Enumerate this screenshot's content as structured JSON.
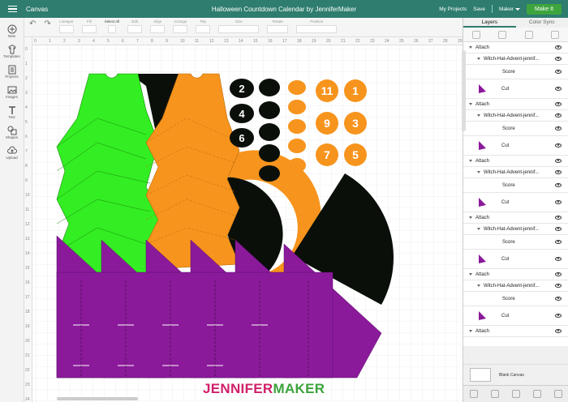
{
  "topbar": {
    "app_title": "Canvas",
    "doc_title": "Halloween Countdown Calendar by JenniferMaker",
    "my_projects": "My Projects",
    "save": "Save",
    "machine": "Maker",
    "make_it": "Make It",
    "color": "#2e7d6e"
  },
  "toolbar": {
    "items": [
      "Linetype",
      "Fill",
      "Select All",
      "Edit",
      "Align",
      "Arrange",
      "Flip",
      "Size",
      "Rotate",
      "Position"
    ]
  },
  "sidebar": {
    "items": [
      {
        "label": "New",
        "icon": "plus-icon"
      },
      {
        "label": "Templates",
        "icon": "shirt-icon"
      },
      {
        "label": "Projects",
        "icon": "projects-icon"
      },
      {
        "label": "Images",
        "icon": "image-icon"
      },
      {
        "label": "Text",
        "icon": "text-icon"
      },
      {
        "label": "Shapes",
        "icon": "shapes-icon"
      },
      {
        "label": "Upload",
        "icon": "cloud-upload-icon"
      }
    ]
  },
  "rulers": {
    "top": [
      "0",
      "1",
      "2",
      "3",
      "4",
      "5",
      "6",
      "7",
      "8",
      "9",
      "10",
      "11",
      "12",
      "13",
      "14",
      "15",
      "16",
      "17",
      "18",
      "19",
      "20",
      "21",
      "22",
      "23",
      "24",
      "25",
      "26",
      "27",
      "28",
      "29"
    ],
    "left": [
      "0",
      "1",
      "2",
      "3",
      "4",
      "5",
      "6",
      "7",
      "8",
      "9",
      "10",
      "11",
      "12",
      "13",
      "14",
      "15",
      "16",
      "17",
      "18",
      "19",
      "20",
      "21",
      "22",
      "23",
      "24"
    ]
  },
  "canvas": {
    "cauldron_numbers": [
      "2",
      "4",
      "6"
    ],
    "pumpkin_numbers": [
      "11",
      "1",
      "9",
      "3",
      "7",
      "5"
    ],
    "colors": {
      "green": "#33ee22",
      "orange": "#f7941d",
      "black": "#0a0f0a",
      "purple": "#8b1a9b"
    }
  },
  "logo": {
    "part1": "JENNIFER",
    "part2": "MAKER"
  },
  "panel": {
    "tabs": [
      "Layers",
      "Color Sync"
    ],
    "groups": [
      {
        "attach": "Attach",
        "name": "Witch-Hat-Advent-jennif...",
        "score": "Score",
        "cut": "Cut"
      },
      {
        "attach": "Attach",
        "name": "Witch-Hat-Advent-jennif...",
        "score": "Score",
        "cut": "Cut"
      },
      {
        "attach": "Attach",
        "name": "Witch-Hat-Advent-jennif...",
        "score": "Score",
        "cut": "Cut"
      },
      {
        "attach": "Attach",
        "name": "Witch-Hat-Advent-jennif...",
        "score": "Score",
        "cut": "Cut"
      },
      {
        "attach": "Attach",
        "name": "Witch-Hat-Advent-jennif...",
        "score": "Score",
        "cut": "Cut"
      }
    ],
    "last_attach": "Attach",
    "blank_canvas": "Blank Canvas"
  }
}
